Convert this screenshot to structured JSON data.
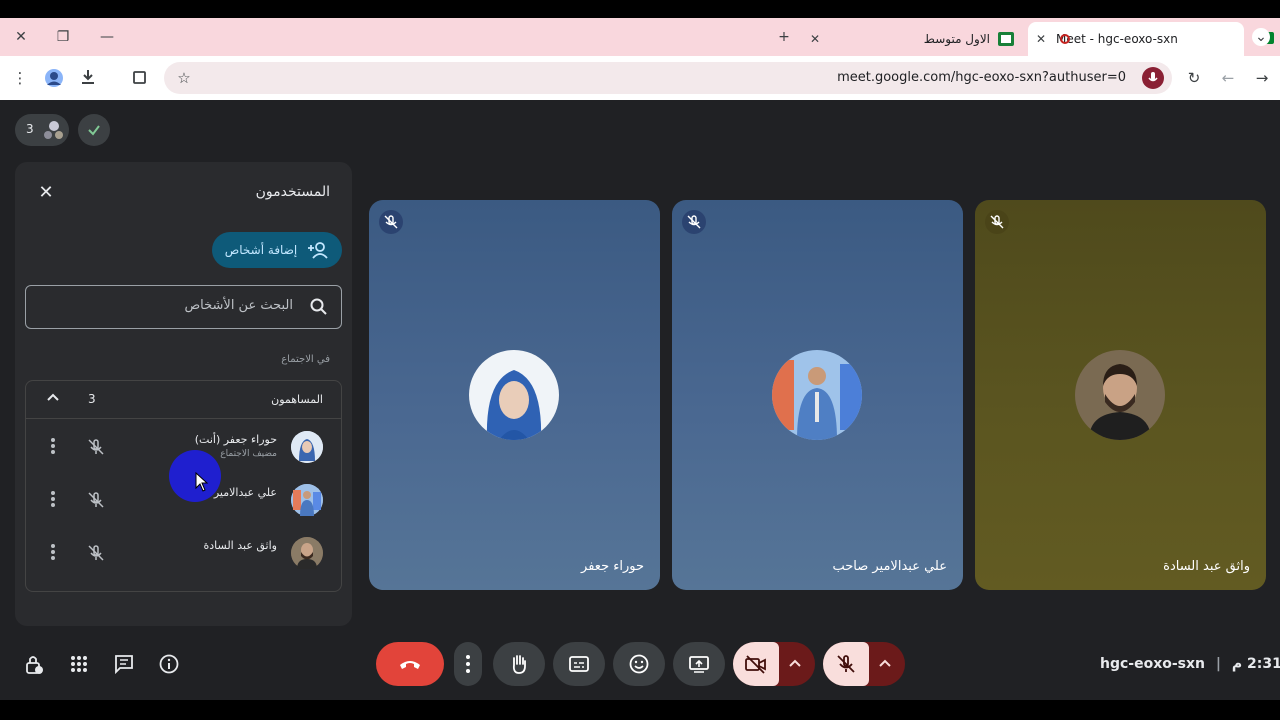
{
  "browser": {
    "tabs": [
      {
        "title": "Meet - hgc-eoxo-sxn",
        "active": true
      },
      {
        "title": "الاول متوسط",
        "active": false
      }
    ],
    "url": "meet.google.com/hgc-eoxo-sxn?authuser=0"
  },
  "top_chip": {
    "count": "3"
  },
  "panel": {
    "title": "المستخدمون",
    "add_button": "إضافة أشخاص",
    "search_placeholder": "البحث عن الأشخاص",
    "section_label": "في الاجتماع",
    "group_label": "المساهمون",
    "group_count": "3",
    "participants": [
      {
        "name": "حوراء جعفر (أنت)",
        "role": "مضيف الاجتماع"
      },
      {
        "name": "علي عبدالامير صاحب",
        "role": ""
      },
      {
        "name": "واثق عبد السادة",
        "role": ""
      }
    ]
  },
  "tiles": [
    {
      "name": "حوراء جعفر",
      "color": "#3f5f86"
    },
    {
      "name": "علي عبدالامير صاحب",
      "color": "#3f5f86"
    },
    {
      "name": "واثق عبد السادة",
      "color": "#5c5620"
    }
  ],
  "footer": {
    "meeting_code": "hgc-eoxo-sxn",
    "time": "2:31 م"
  },
  "colors": {
    "accent": "#0e5a79",
    "end_call": "#e2443a",
    "danger_dark": "#6b1a1a"
  }
}
